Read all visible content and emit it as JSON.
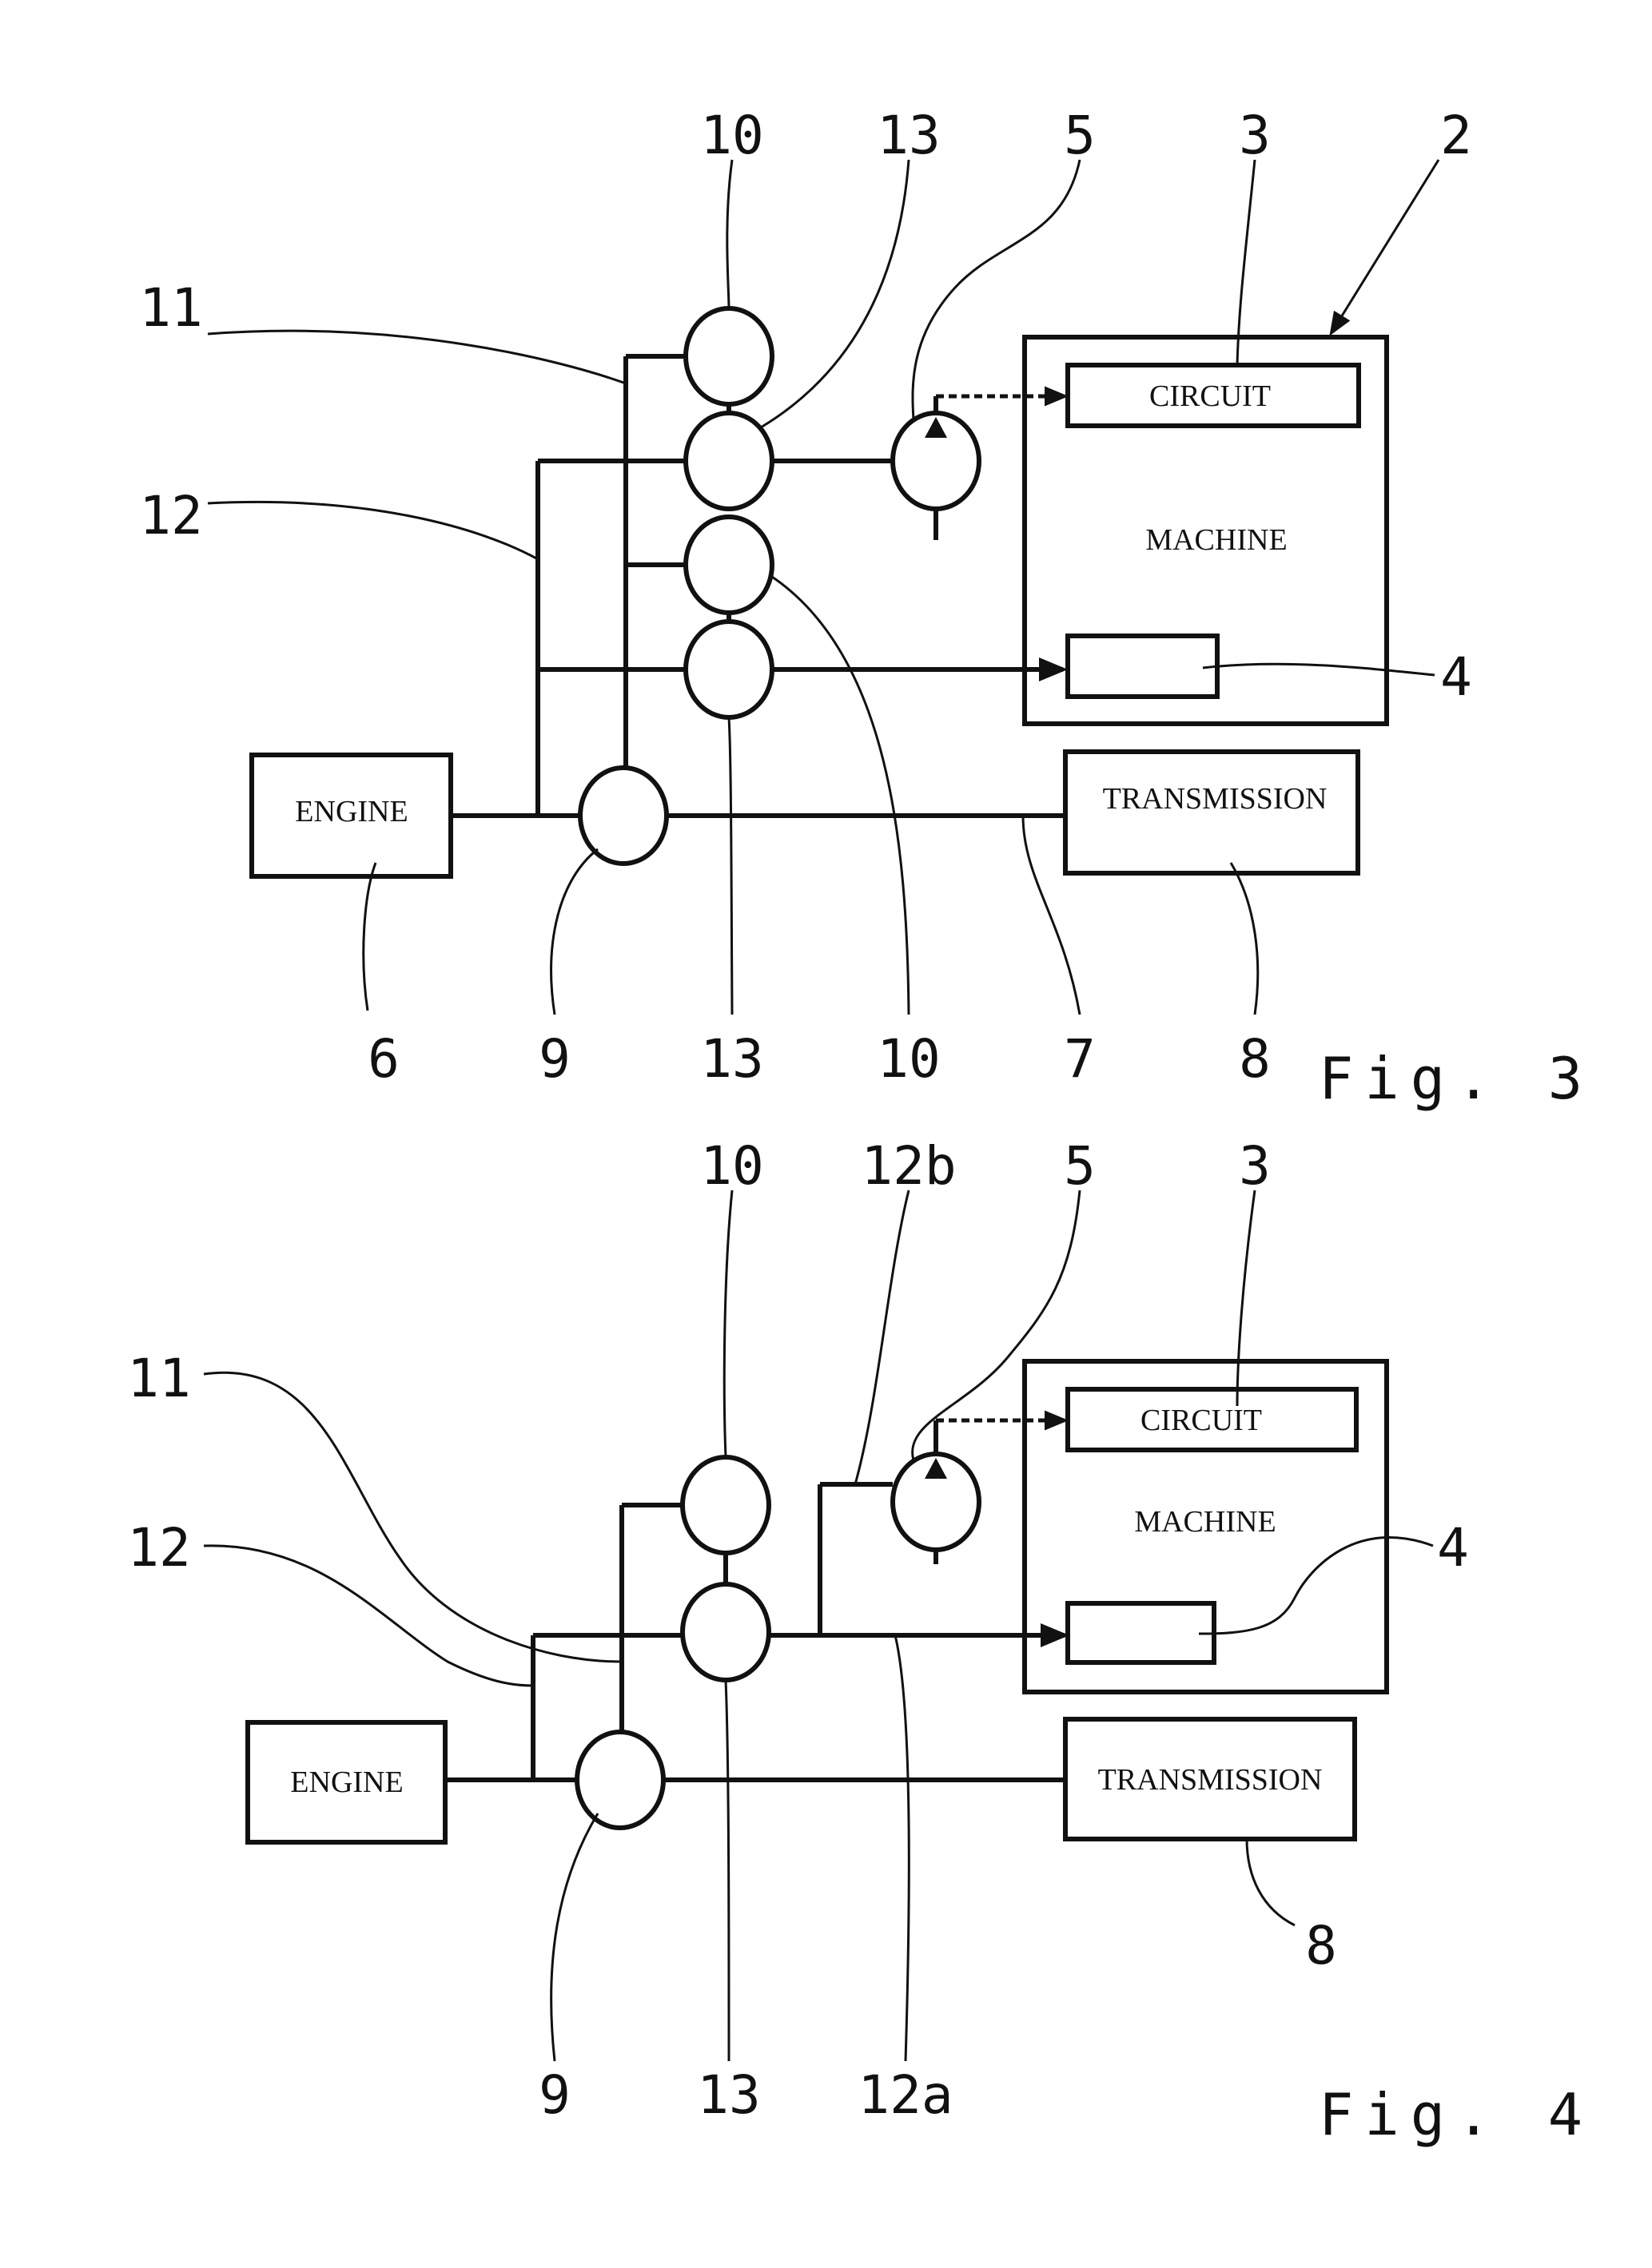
{
  "figures": [
    {
      "caption": "Fig. 3",
      "boxes": {
        "engine": "ENGINE",
        "transmission": "TRANSMISSION",
        "machine": "MACHINE",
        "circuit": "CIRCUIT",
        "unit4": ""
      },
      "refs": {
        "top": [
          "10",
          "13",
          "5",
          "3",
          "2"
        ],
        "left": [
          "11",
          "12"
        ],
        "right": [
          "4"
        ],
        "bottom": [
          "6",
          "9",
          "13",
          "10",
          "7",
          "8"
        ]
      }
    },
    {
      "caption": "Fig. 4",
      "boxes": {
        "engine": "ENGINE",
        "transmission": "TRANSMISSION",
        "machine": "MACHINE",
        "circuit": "CIRCUIT",
        "unit4": ""
      },
      "refs": {
        "top": [
          "10",
          "12b",
          "5",
          "3"
        ],
        "left": [
          "11",
          "12"
        ],
        "right": [
          "4"
        ],
        "bottom": [
          "9",
          "13",
          "12a",
          "8"
        ]
      }
    }
  ]
}
